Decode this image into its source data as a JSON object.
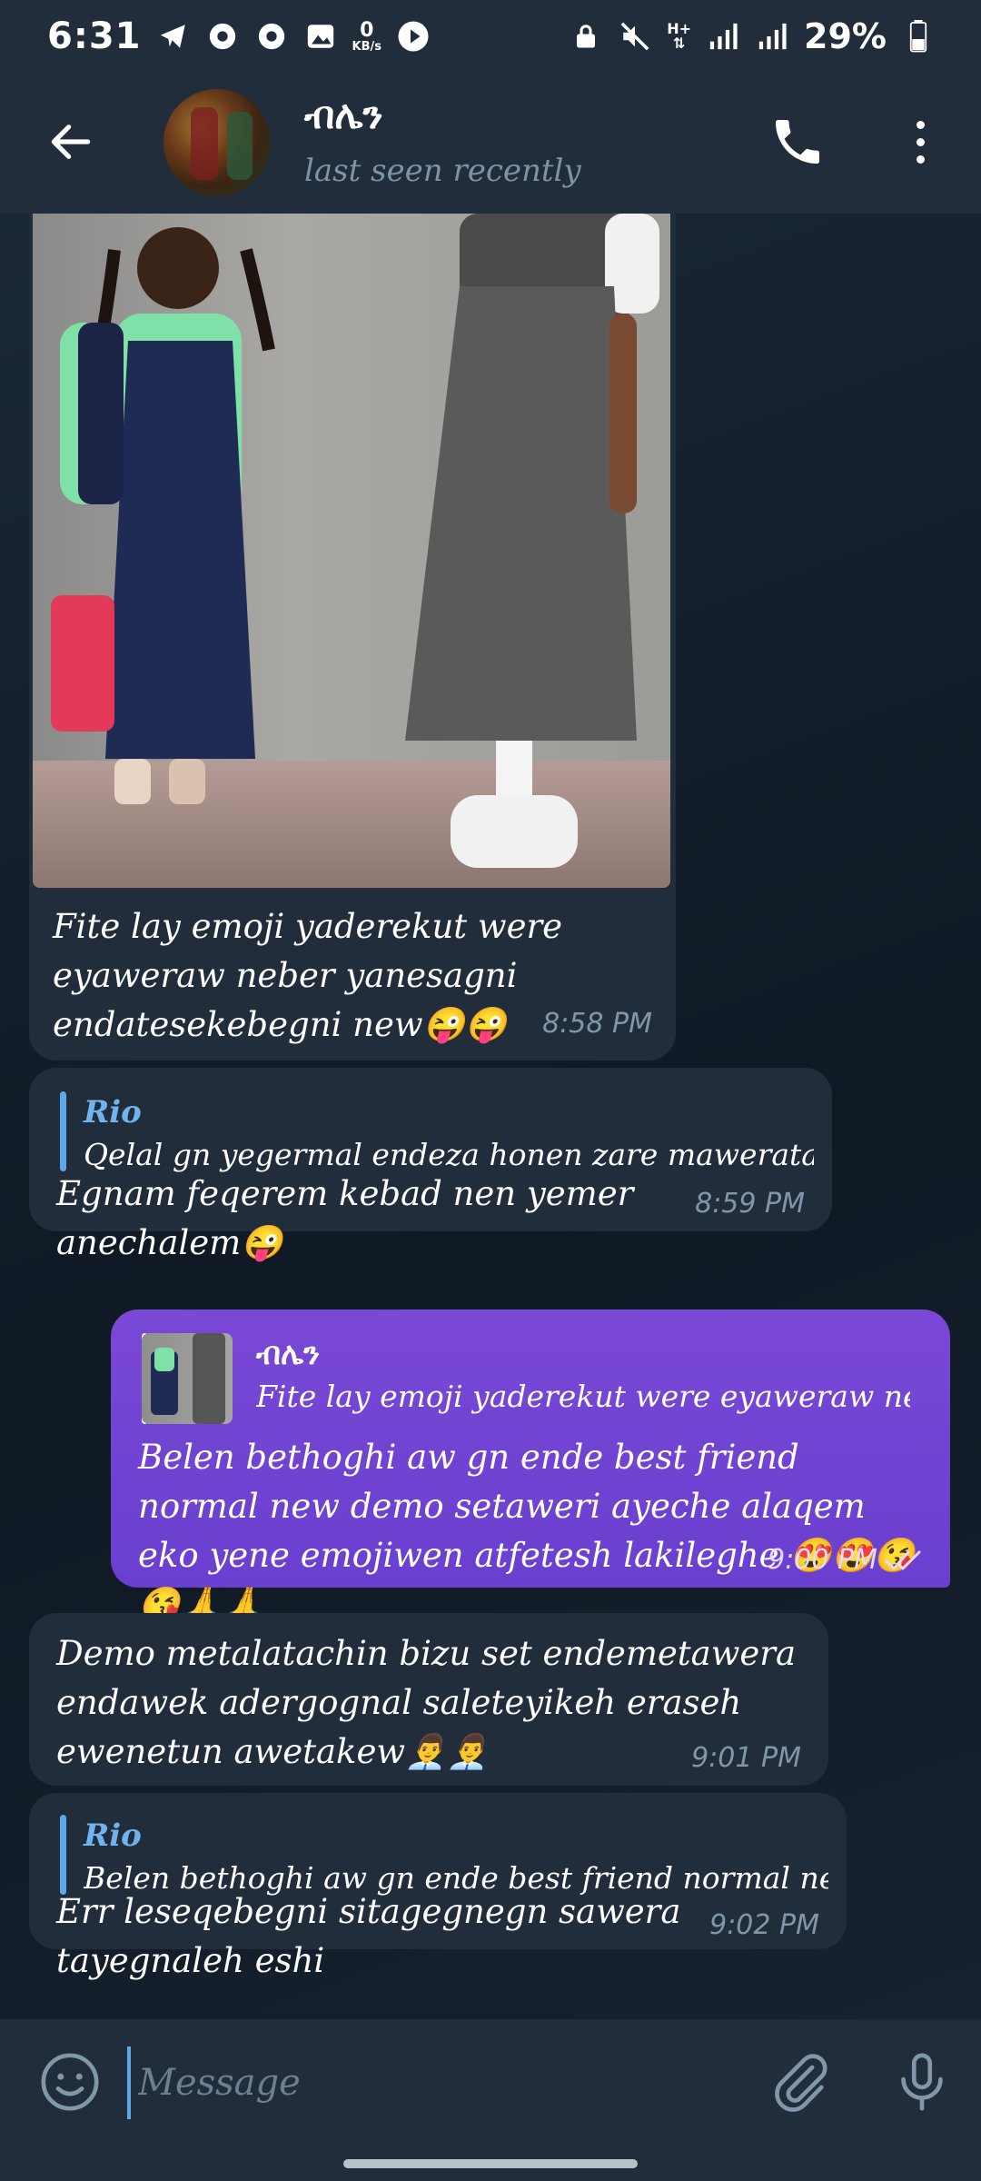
{
  "status_bar": {
    "time": "6:31",
    "speed_value": "0",
    "speed_unit": "KB/s",
    "network": "H+",
    "battery": "29%",
    "icons": [
      "telegram-icon",
      "chrome-icon",
      "chrome-icon",
      "gallery-icon",
      "speed-icon",
      "play-icon",
      "lock-icon",
      "mute-icon",
      "network-arrows-icon",
      "signal-icon",
      "signal-icon",
      "battery-icon"
    ]
  },
  "header": {
    "contact_name": "ብሌን",
    "status": "last seen recently"
  },
  "messages": [
    {
      "direction": "incoming",
      "has_photo": true,
      "text": "Fite lay emoji yaderekut were eyaweraw neber yanesagni endatesekebegni new😜😜",
      "time": "8:58 PM"
    },
    {
      "direction": "incoming",
      "reply_to_name": "Rio",
      "reply_to_text": "Qelal gn yegermal endeza honen zare maweratachen...",
      "text": "Egnam feqerem kebad nen yemer anechalem😜",
      "time": "8:59 PM"
    },
    {
      "direction": "outgoing",
      "reply_to_name": "ብሌን",
      "reply_to_text": "Fite lay emoji yaderekut were eyaweraw neber...",
      "text": "Belen bethoghi aw gn ende best friend normal new demo setaweri ayeche alaqem eko yene emojiwen atfetesh lakileghe 😍😍😘😘🙏🙏",
      "time": "9:00 PM"
    },
    {
      "direction": "incoming",
      "text": "Demo metalatachin bizu set endemetawera endawek adergognal saleteyikeh eraseh ewenetun awetakew👨‍💼👨‍💼",
      "time": "9:01 PM"
    },
    {
      "direction": "incoming",
      "reply_to_name": "Rio",
      "reply_to_text": "Belen bethoghi aw gn ende best friend normal new d...",
      "text": "Err leseqebegni sitagegnegn sawera tayegnaleh eshi",
      "time": "9:02 PM"
    }
  ],
  "input": {
    "placeholder": "Message"
  },
  "colors": {
    "header_bg": "#212d3b",
    "incoming_bubble": "#212d3b",
    "outgoing_bubble": "#7046d2",
    "accent": "#5da8e8"
  }
}
